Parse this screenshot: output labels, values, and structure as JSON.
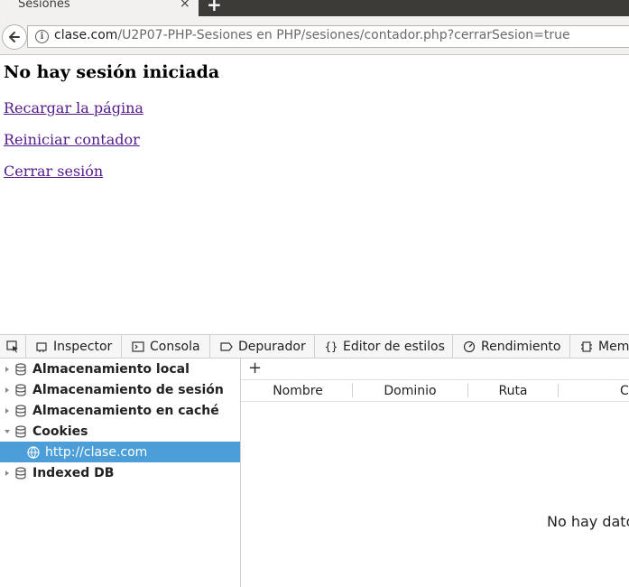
{
  "browser": {
    "tab": {
      "title": "Sesiones",
      "close_glyph": "×",
      "new_tab_glyph": "+"
    },
    "url": {
      "domain": "clase.com",
      "path": "/U2P07-PHP-Sesiones en PHP/sesiones/contador.php?cerrarSesion=true"
    }
  },
  "page": {
    "heading": "No hay sesión iniciada",
    "links": [
      "Recargar la página",
      "Reiniciar contador",
      "Cerrar sesión"
    ],
    "link_color": "#551a8b"
  },
  "devtools": {
    "tabs": [
      "Inspector",
      "Consola",
      "Depurador",
      "Editor de estilos",
      "Rendimiento",
      "Mem"
    ],
    "storage_tree": [
      {
        "label": "Almacenamiento local",
        "expanded": false
      },
      {
        "label": "Almacenamiento de sesión",
        "expanded": false
      },
      {
        "label": "Almacenamiento en caché",
        "expanded": false
      },
      {
        "label": "Cookies",
        "expanded": true
      },
      {
        "label": "http://clase.com",
        "selected": true,
        "child": true
      },
      {
        "label": "Indexed DB",
        "expanded": false
      }
    ],
    "table": {
      "add_glyph": "+",
      "columns": [
        "Nombre",
        "Dominio",
        "Ruta",
        "C"
      ],
      "empty_message": "No hay dato"
    },
    "selection_color": "#4c9ed9"
  }
}
